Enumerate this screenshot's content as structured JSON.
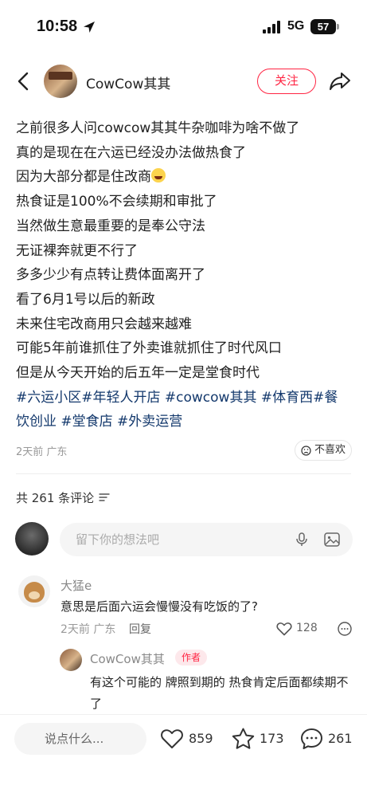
{
  "status_bar": {
    "time": "10:58",
    "network": "5G",
    "battery": "57",
    "icons": [
      "location-arrow-icon",
      "signal-icon",
      "battery-icon"
    ]
  },
  "header": {
    "author_name": "CowCow其其",
    "follow_label": "关注",
    "icons": [
      "back-icon",
      "share-icon"
    ]
  },
  "post": {
    "lines": [
      "之前很多人问cowcow其其牛杂咖啡为啥不做了",
      "真的是现在在六运已经没办法做热食了",
      "因为大部分都是住改商",
      "热食证是100%不会续期和审批了",
      "当然做生意最重要的是奉公守法",
      "无证裸奔就更不行了",
      "多多少少有点转让费体面离开了",
      "看了6月1号以后的新政",
      "未来住宅改商用只会越来越难",
      "可能5年前谁抓住了外卖谁就抓住了时代风口",
      "但是从今天开始的后五年一定是堂食时代"
    ],
    "hashtags_line1": "#六运小区#年轻人开店 #cowcow其其 #体育西#餐",
    "hashtags_line2": "饮创业 #堂食店 #外卖运营",
    "meta": "2天前 广东",
    "dislike_label": "不喜欢"
  },
  "comments": {
    "count_label": "共 261 条评论",
    "input_placeholder": "留下你的想法吧",
    "items": [
      {
        "name": "大猛e",
        "text": "意思是后面六运会慢慢没有吃饭的了?",
        "meta": "2天前 广东",
        "reply_label": "回复",
        "likes": "128",
        "replies": [
          {
            "name": "CowCow其其",
            "badge": "作者",
            "text": "有这个可能的 牌照到期的 热食肯定后面都续期不了"
          }
        ]
      }
    ]
  },
  "bottom_bar": {
    "input_placeholder": "说点什么...",
    "likes": "859",
    "stars": "173",
    "comments": "261"
  },
  "colors": {
    "accent": "#ff2442",
    "hashtag": "#13386c",
    "muted": "#999999"
  }
}
